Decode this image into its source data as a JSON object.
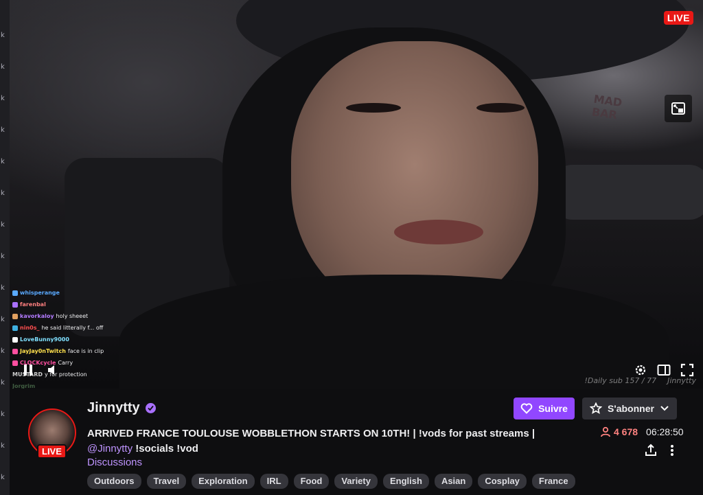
{
  "player": {
    "live_badge": "LIVE",
    "watermark_left": "!Daily sub 157 / 77",
    "watermark_right": "Jinnytty"
  },
  "chat_overlay": [
    {
      "user": "whisperange",
      "message": "",
      "color": "#5aa9ff"
    },
    {
      "user": "farenbal",
      "message": "",
      "color": "#ff7f7f"
    },
    {
      "user": "kavorkaloy",
      "message": "holy sheeet",
      "color": "#b37bff"
    },
    {
      "user": "nin0s_",
      "message": "he said litterally f... off",
      "color": "#ff4f4f"
    },
    {
      "user": "LoveBunny9000",
      "message": "",
      "color": "#7fe0ff"
    },
    {
      "user": "JayJay0nTwitch",
      "message": "face is in clip",
      "color": "#ffe14d"
    },
    {
      "user": "CLOCKcycle",
      "message": "Carry",
      "color": "#ff4fa0"
    },
    {
      "user": "MUSTARD",
      "message": "y for protection",
      "color": "#cccccc"
    },
    {
      "user": "Jorgrim",
      "message": "",
      "color": "#7fbf7f"
    }
  ],
  "channel": {
    "name": "Jinnytty",
    "avatar_live": "LIVE",
    "title_main": "ARRIVED FRANCE TOULOUSE WOBBLETHON STARTS ON 10TH! | !vods for past streams |",
    "title_mention": "@Jinnytty",
    "title_rest": " !socials !vod",
    "category": "Discussions",
    "follow_label": "Suivre",
    "subscribe_label": "S'abonner",
    "viewers": "4 678",
    "uptime": "06:28:50",
    "tags": [
      "Outdoors",
      "Travel",
      "Exploration",
      "IRL",
      "Food",
      "Variety",
      "English",
      "Asian",
      "Cosplay",
      "France"
    ]
  },
  "colors": {
    "brand_purple": "#9147ff",
    "live_red": "#e91916",
    "viewer_red": "#ff8280",
    "link_purple": "#bf94ff"
  }
}
